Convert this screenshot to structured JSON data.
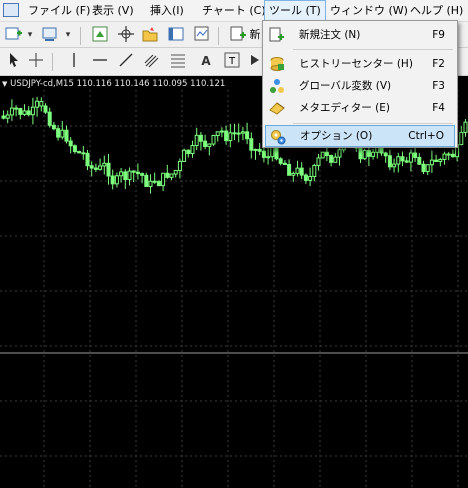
{
  "menu": [
    "ファイル (F)",
    "表示 (V)",
    "挿入(I)",
    "チャート (C)",
    "ツール (T)",
    "ウィンドウ (W)",
    "ヘルプ (H)"
  ],
  "toolbar": {
    "new_order_partial": "新"
  },
  "chart": {
    "header": "USDJPY-cd,M15  110.116 110.146 110.095 110.121"
  },
  "dropdown": {
    "items": [
      {
        "label": "新規注文 (N)",
        "shortcut": "F9",
        "icon": "new-order-icon"
      },
      {
        "label": "ヒストリーセンター (H)",
        "shortcut": "F2",
        "icon": "history-center-icon"
      },
      {
        "label": "グローバル変数 (V)",
        "shortcut": "F3",
        "icon": "global-variables-icon"
      },
      {
        "label": "メタエディター (E)",
        "shortcut": "F4",
        "icon": "metaeditor-icon"
      },
      {
        "label": "オプション (O)",
        "shortcut": "Ctrl+O",
        "icon": "options-icon"
      }
    ]
  },
  "colors": {
    "candle": "#7cff7c",
    "background": "#000000",
    "grid": "#3a3a3a"
  }
}
